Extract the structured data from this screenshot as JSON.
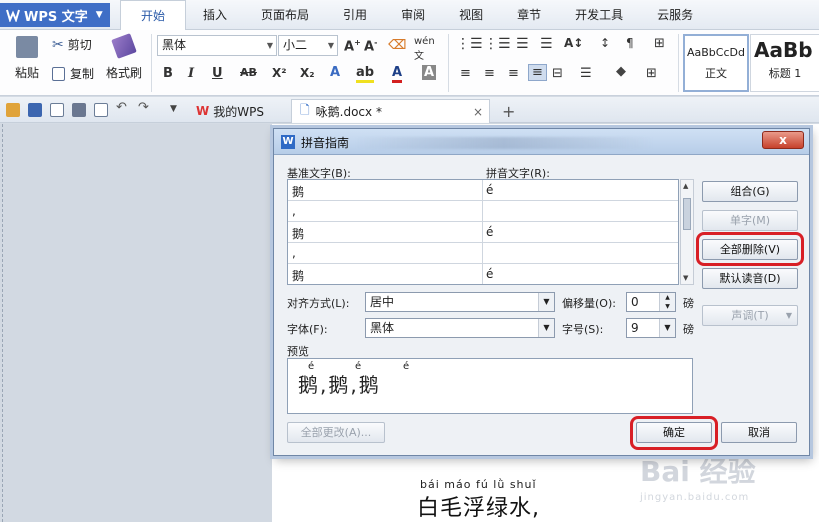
{
  "app": {
    "logo_label": "WPS 文字",
    "menu": [
      "开始",
      "插入",
      "页面布局",
      "引用",
      "审阅",
      "视图",
      "章节",
      "开发工具",
      "云服务"
    ]
  },
  "ribbon": {
    "paste": "粘贴",
    "cut": "剪切",
    "copy": "复制",
    "format_painter": "格式刷",
    "font_name": "黑体",
    "font_size": "小二",
    "style_normal_preview": "AaBbCcDd",
    "style_normal": "正文",
    "style_h1_preview": "AaBb",
    "style_h1": "标题 1",
    "bold": "B",
    "italic": "I",
    "underline": "U",
    "strike": "AB",
    "sup": "X²",
    "sub": "X₂"
  },
  "tabs": {
    "my_wps": "我的WPS",
    "doc": "咏鹅.docx *",
    "add": "+"
  },
  "document": {
    "pinyin": "bái máo fú lǜ shuǐ",
    "text": "白毛浮绿水,"
  },
  "watermark": {
    "text": "Bai 经验",
    "sub": "jingyan.baidu.com"
  },
  "dialog": {
    "title": "拼音指南",
    "close": "x",
    "col_base": "基准文字(B):",
    "col_pinyin": "拼音文字(R):",
    "rows": [
      {
        "base": "鹅",
        "pinyin": "é"
      },
      {
        "base": ",",
        "pinyin": ""
      },
      {
        "base": "鹅",
        "pinyin": "é"
      },
      {
        "base": ",",
        "pinyin": ""
      },
      {
        "base": "鹅",
        "pinyin": "é"
      }
    ],
    "btn_combine": "组合(G)",
    "btn_single": "单字(M)",
    "btn_clear_all": "全部删除(V)",
    "btn_default": "默认读音(D)",
    "btn_tone": "声调(T)",
    "align_label": "对齐方式(L):",
    "align_value": "居中",
    "offset_label": "偏移量(O):",
    "offset_value": "0",
    "offset_unit": "磅",
    "font_label": "字体(F):",
    "font_value": "黑体",
    "size_label": "字号(S):",
    "size_value": "9",
    "size_unit": "磅",
    "preview_label": "预览",
    "preview_text": "鹅,鹅,鹅",
    "preview_pinyin": "é",
    "btn_change_all": "全部更改(A)...",
    "btn_ok": "确定",
    "btn_cancel": "取消"
  }
}
